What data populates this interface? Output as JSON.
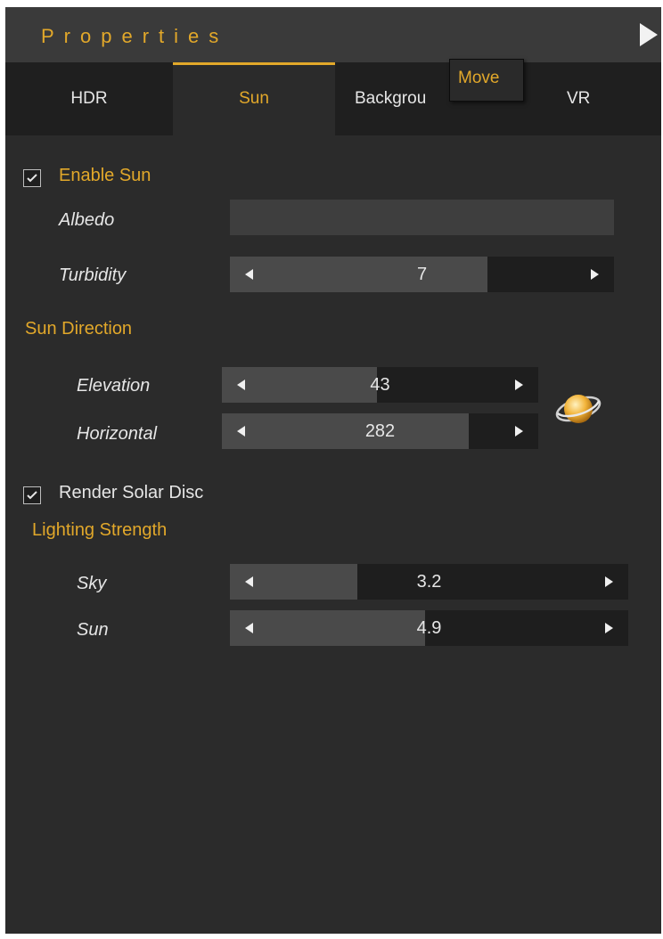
{
  "panel": {
    "title": "Properties",
    "collapse_icon": "triangle-right-icon"
  },
  "tabs": [
    {
      "label": "HDR",
      "active": false
    },
    {
      "label": "Sun",
      "active": true
    },
    {
      "label": "Backgrou",
      "active": false
    },
    {
      "label": "VR",
      "active": false
    }
  ],
  "tooltip": {
    "text": "Move"
  },
  "sun": {
    "enable_label": "Enable Sun",
    "enable_checked": true,
    "albedo_label": "Albedo",
    "turbidity": {
      "label": "Turbidity",
      "value": "7",
      "fraction": 0.67
    }
  },
  "direction": {
    "heading": "Sun Direction",
    "elevation": {
      "label": "Elevation",
      "value": "43",
      "fraction": 0.49
    },
    "horizontal": {
      "label": "Horizontal",
      "value": "282",
      "fraction": 0.78
    },
    "widget_icon": "sun-orbit-icon"
  },
  "render_solar_disc": {
    "label": "Render Solar Disc",
    "checked": true
  },
  "lighting": {
    "heading": "Lighting Strength",
    "sky": {
      "label": "Sky",
      "value": "3.2",
      "fraction": 0.32
    },
    "sun": {
      "label": "Sun",
      "value": "4.9",
      "fraction": 0.49
    }
  },
  "colors": {
    "accent": "#e2a82a",
    "panel_bg": "#2b2b2b",
    "slider_bg": "#1e1e1e",
    "slider_fill": "#4a4a4a"
  }
}
